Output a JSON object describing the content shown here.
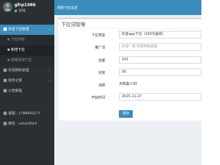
{
  "user": {
    "name": "gfrp1986",
    "status": "在线"
  },
  "topbar": {
    "title": "增粉下拉设定"
  },
  "sidebar": {
    "items": [
      {
        "label": "抖音下拉管理",
        "caret": "‹"
      },
      {
        "label": "下拉列表"
      },
      {
        "label": "新增下拉"
      },
      {
        "label": "批量添加下拉"
      },
      {
        "label": "抖音刷粉管理",
        "caret": "‹"
      },
      {
        "label": "财务记录",
        "caret": "‹"
      },
      {
        "label": "公告教程"
      }
    ],
    "contacts": [
      {
        "label": "客服：1784642177"
      },
      {
        "label": "微信：sotuli2014"
      }
    ]
  },
  "form": {
    "panel_title": "下拉词管理",
    "type_label": "下拉类型",
    "type_value": "抖音app下拉（200元最低）",
    "keyword_label": "推广词",
    "keyword_placeholder": "抖音厂家/无缝纯钛金属",
    "flow_label": "流量",
    "flow_value": "100",
    "days_label": "天数",
    "days_value": "30",
    "cost_label": "消费",
    "cost_value": "天数最少30",
    "start_label": "开始时间",
    "start_value": "2025-11-27",
    "save_label": "保存"
  },
  "colors": {
    "accent": "#3c8dbc",
    "sidebar_bg": "#2a2f34"
  }
}
